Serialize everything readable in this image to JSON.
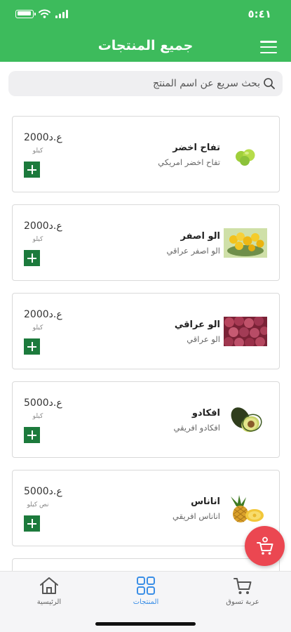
{
  "status_bar": {
    "time": "٥:٤١"
  },
  "header": {
    "title": "جميع المنتجات"
  },
  "search": {
    "placeholder": "بحث سريع عن اسم المنتج"
  },
  "products": [
    {
      "name": "تفاح اخضر",
      "description": "تفاح اخضر امريكي",
      "price": "ع.د2000",
      "unit": "كيلو",
      "image": "green-apples"
    },
    {
      "name": "الو اصفر",
      "description": "الو اصفر عراقي",
      "price": "ع.د2000",
      "unit": "كيلو",
      "image": "yellow-plums"
    },
    {
      "name": "الو عراقي",
      "description": "الو عراقي",
      "price": "ع.د2000",
      "unit": "كيلو",
      "image": "red-plums"
    },
    {
      "name": "افكادو",
      "description": "افكادو افريقي",
      "price": "ع.د5000",
      "unit": "كيلو",
      "image": "avocado"
    },
    {
      "name": "اناناس",
      "description": "اناناس افريقي",
      "price": "ع.د5000",
      "unit": "نص كيلو",
      "image": "pineapple"
    }
  ],
  "bottom_nav": {
    "home": "الرئيسية",
    "products": "المنتجات",
    "cart": "عربة تسوق",
    "active": "products"
  },
  "colors": {
    "header": "#3dbb5c",
    "add_button": "#1c7a3c",
    "cart_fab": "#eb4751",
    "active_tab": "#3a8ee6"
  }
}
